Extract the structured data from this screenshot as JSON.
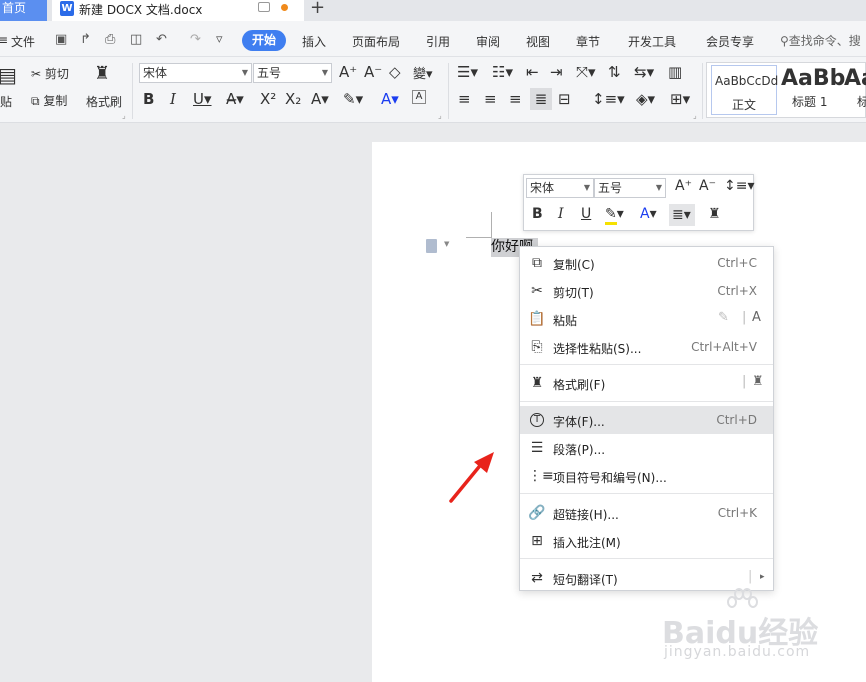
{
  "titlebar": {
    "home_tab": "首页",
    "doc_tab": "新建 DOCX 文档.docx",
    "add_tab": "+"
  },
  "menu": {
    "file": "文件",
    "items": [
      "开始",
      "插入",
      "页面布局",
      "引用",
      "审阅",
      "视图",
      "章节",
      "开发工具",
      "会员专享"
    ],
    "active": "开始",
    "search_placeholder": "查找命令、搜"
  },
  "ribbon": {
    "paste": "贴",
    "cut": "剪切",
    "copy": "复制",
    "format_painter": "格式刷",
    "font_name": "宋体",
    "font_size": "五号",
    "styles": [
      {
        "sample": "AaBbCcDd",
        "name": "正文"
      },
      {
        "sample": "AaBb",
        "name": "标题 1"
      },
      {
        "sample": "Aa",
        "name": "标"
      }
    ]
  },
  "document": {
    "selected_text": "你好啊"
  },
  "mini_toolbar": {
    "font_name": "宋体",
    "font_size": "五号"
  },
  "context_menu": {
    "items": [
      {
        "label": "复制(C)",
        "shortcut": "Ctrl+C",
        "icon": "copy-icon"
      },
      {
        "label": "剪切(T)",
        "shortcut": "Ctrl+X",
        "icon": "scissors-icon"
      },
      {
        "label": "粘贴",
        "shortcut": "",
        "icon": "paste-icon"
      },
      {
        "label": "选择性粘贴(S)...",
        "shortcut": "Ctrl+Alt+V",
        "icon": "paste-special-icon"
      },
      {
        "label": "格式刷(F)",
        "shortcut": "",
        "icon": "format-painter-icon"
      },
      {
        "label": "字体(F)...",
        "shortcut": "Ctrl+D",
        "icon": "font-icon"
      },
      {
        "label": "段落(P)...",
        "shortcut": "",
        "icon": "paragraph-icon"
      },
      {
        "label": "项目符号和编号(N)...",
        "shortcut": "",
        "icon": "list-icon"
      },
      {
        "label": "超链接(H)...",
        "shortcut": "Ctrl+K",
        "icon": "link-icon"
      },
      {
        "label": "插入批注(M)",
        "shortcut": "",
        "icon": "comment-icon"
      },
      {
        "label": "短句翻译(T)",
        "shortcut": "",
        "icon": "translate-icon"
      }
    ],
    "highlighted": "字体(F)..."
  },
  "watermark": {
    "main": "Baidu经验",
    "sub": "jingyan.baidu.com"
  },
  "colors": {
    "accent": "#3f7ef0",
    "home_tab": "#5b8ff0",
    "arrow": "#e8231b",
    "highlight_yellow": "#f5e100",
    "font_color_blue": "#1b3df0"
  }
}
